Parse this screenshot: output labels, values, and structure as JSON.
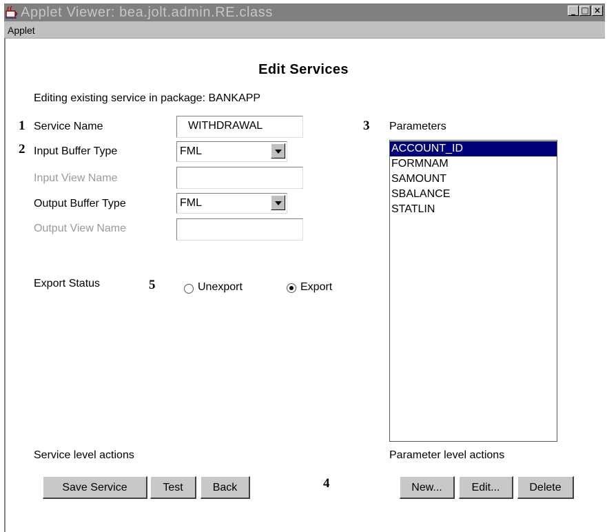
{
  "window": {
    "title": "Applet Viewer: bea.jolt.admin.RE.class",
    "controls": [
      "_",
      "□",
      "×"
    ]
  },
  "menubar": {
    "applet_label": "Applet"
  },
  "page": {
    "title": "Edit Services",
    "subtitle": "Editing existing service in package: BANKAPP"
  },
  "form": {
    "service_name_label": "Service Name",
    "service_name_value": "WITHDRAWAL",
    "input_buffer_type_label": "Input Buffer Type",
    "input_buffer_type_value": "FML",
    "input_view_name_label": "Input View Name",
    "input_view_name_value": "",
    "output_buffer_type_label": "Output Buffer Type",
    "output_buffer_type_value": "FML",
    "output_view_name_label": "Output View Name",
    "output_view_name_value": "",
    "export_status_label": "Export Status",
    "unexport_label": "Unexport",
    "export_label": "Export",
    "selected_export_option": "Export"
  },
  "parameters": {
    "label": "Parameters",
    "items": [
      "ACCOUNT_ID",
      "FORMNAM",
      "SAMOUNT",
      "SBALANCE",
      "STATLIN"
    ],
    "selected": "ACCOUNT_ID"
  },
  "service_actions": {
    "label": "Service level actions",
    "save_label": "Save Service",
    "test_label": "Test",
    "back_label": "Back"
  },
  "parameter_actions": {
    "label": "Parameter level actions",
    "new_label": "New...",
    "edit_label": "Edit...",
    "delete_label": "Delete"
  },
  "callouts": [
    "1",
    "2",
    "3",
    "4",
    "5"
  ],
  "colors": {
    "titlebar": "#808080",
    "title_text": "#c6c6c6",
    "selection": "#00007a",
    "button_face": "#c8c8c8",
    "disabled_text": "#9a9a9a"
  }
}
